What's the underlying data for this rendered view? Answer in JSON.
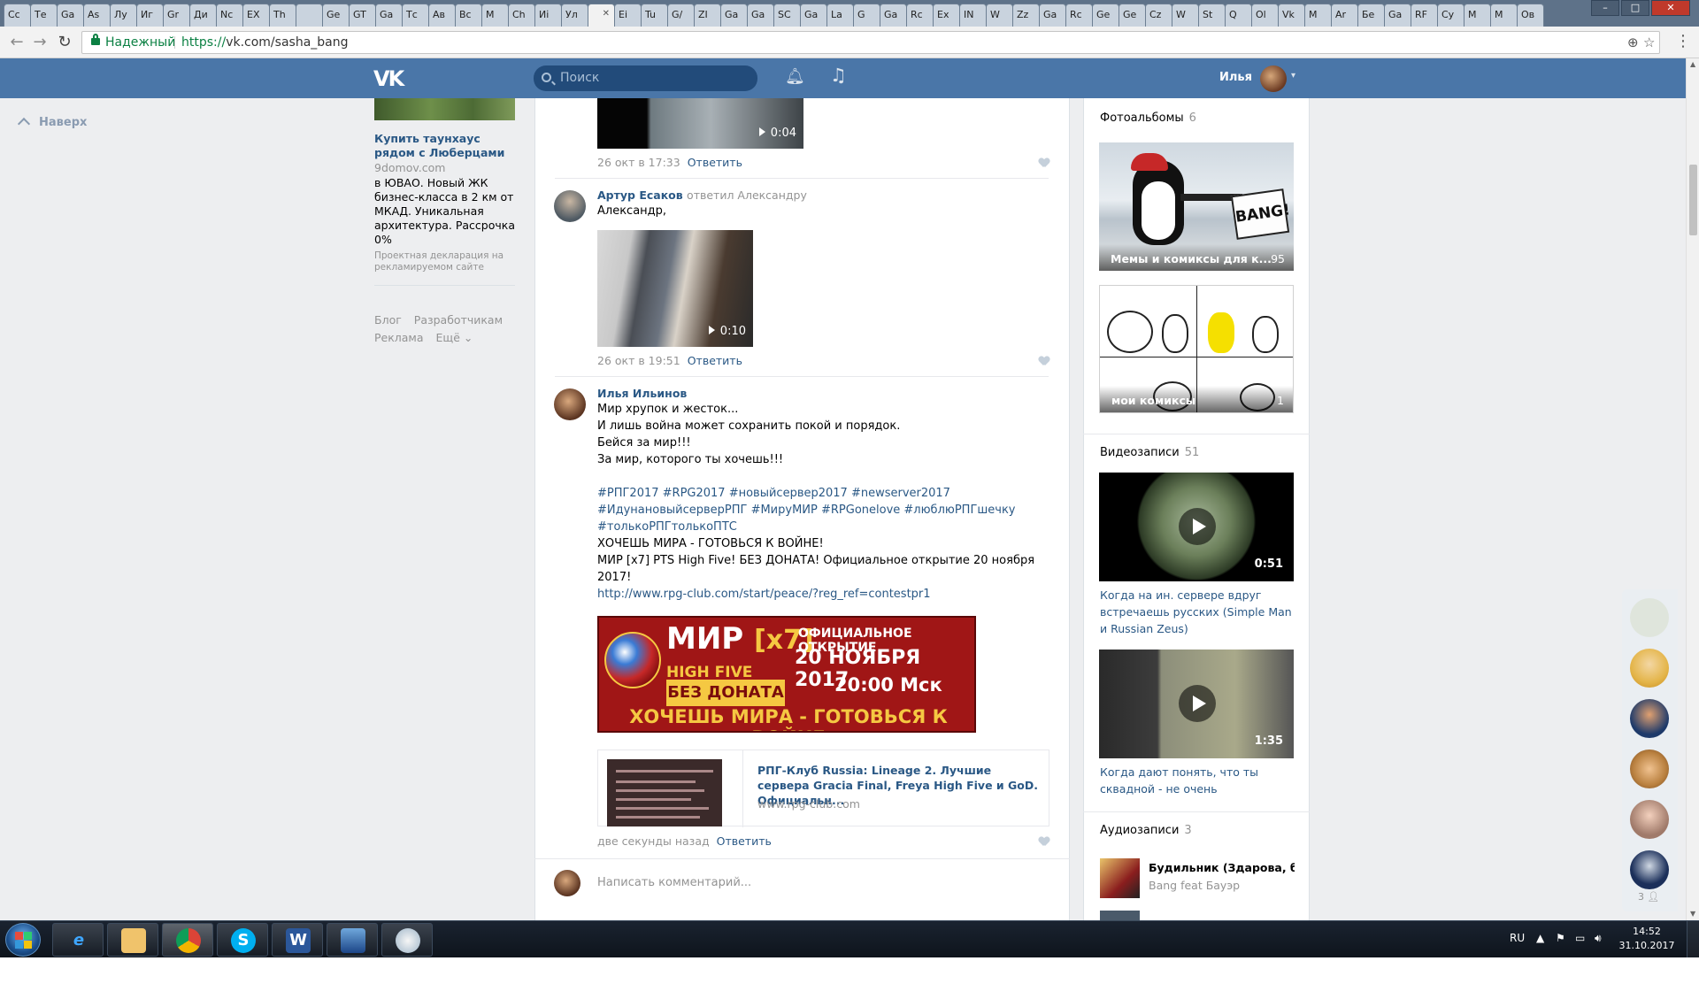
{
  "browser": {
    "tabs": [
      "Сс",
      "Те",
      "Ga",
      "As",
      "Лу",
      "Иг",
      "Gr",
      "Ди",
      "Nc",
      "EX",
      "Th",
      "",
      "Ge",
      "GT",
      "Ga",
      "Тс",
      "Ав",
      "Вс",
      "М",
      "Ch",
      "Иі",
      "Ул",
      "",
      "Ei",
      "Tu",
      "G/",
      "ZI",
      "Ga",
      "Ga",
      "SC",
      "Ga",
      "La",
      "G",
      "Ga",
      "Rc",
      "Ex",
      "IN",
      "W",
      "Zz",
      "Ga",
      "Rc",
      "Ge",
      "Ge",
      "Cz",
      "W",
      "St",
      "Q",
      "Ol",
      "Vk",
      "M",
      "Ar",
      "Бе",
      "Ga",
      "RF",
      "Cy",
      "M",
      "M",
      "Ов"
    ],
    "active_tab_index": 22,
    "secure_label": "Надежный",
    "url_proto": "https://",
    "url_rest": "vk.com/sasha_bang"
  },
  "header": {
    "logo": "VK",
    "search_placeholder": "Поиск",
    "user_name": "Илья"
  },
  "to_top": "Наверх",
  "ad": {
    "title": "Купить таунхаус рядом с Люберцами",
    "domain": "9domov.com",
    "description": "в ЮВАО. Новый ЖК бизнес-класса в 2 км от МКАД. Уникальная архитектура. Рассрочка 0%",
    "legal": "Проектная декларация на рекламируемом сайте"
  },
  "footer_links": [
    "Блог",
    "Разработчикам",
    "Реклама",
    "Ещё ⌄"
  ],
  "comments": [
    {
      "video_duration": "0:04",
      "time": "26 окт в 17:33",
      "reply": "Ответить"
    },
    {
      "author": "Артур Есаков",
      "answered": "ответил Александру",
      "text": "Александр,",
      "video_duration": "0:10",
      "time": "26 окт в 19:51",
      "reply": "Ответить"
    },
    {
      "author": "Илья Ильинов",
      "text": "Мир хрупок и жесток...\nИ лишь война может сохранить покой и порядок.\nБейся за мир!!!\nЗа мир, которого ты хочешь!!!",
      "hashtags": "#РПГ2017 #RPG2017 #новыйсервер2017 #newserver2017\n#ИдунановыйсерверРПГ #МируМИР #RPGonelove #люблюРПГшечку\n#толькоРПГтолькоПТС",
      "text2": "ХОЧЕШЬ МИРА - ГОТОВЬСЯ К ВОЙНЕ!\nМИР [x7] PTS High Five! БЕЗ ДОНАТА! Официальное открытие 20 ноября 2017!",
      "link": "http://www.rpg-club.com/start/peace/?reg_ref=contestpr1",
      "banner": {
        "l1": "МИР",
        "l1b": "[x7]",
        "l2": "ОФИЦИАЛЬНОЕ ОТКРЫТИЕ",
        "l3": "20 НОЯБРЯ 2017",
        "l4": "20:00 Мск",
        "l5": "HIGH FIVE",
        "l6": "БЕЗ ДОНАТА",
        "l7": "ХОЧЕШЬ МИРА - ГОТОВЬСЯ К ВОЙНЕ"
      },
      "snippet_title": "РПГ-Клуб Russia: Lineage 2. Лучшие сервера Gracia Final, Freya High Five и GoD. Официальн...",
      "snippet_domain": "www.rpg-club.com",
      "time": "две секунды назад",
      "reply": "Ответить"
    }
  ],
  "write_comment_placeholder": "Написать комментарий...",
  "right": {
    "albums_title": "Фотоальбомы",
    "albums_count": "6",
    "albums": [
      {
        "name": "Мемы и комиксы для к...",
        "count": "95",
        "badge": "BANG!"
      },
      {
        "name": "мои комиксы",
        "count": "1"
      }
    ],
    "videos_title": "Видеозаписи",
    "videos_count": "51",
    "videos": [
      {
        "duration": "0:51",
        "caption": "Когда на ин. сервере вдруг встречаешь русских (Simple Man и Russian Zeus)"
      },
      {
        "duration": "1:35",
        "caption": "Когда дают понять, что ты сквадной - не очень"
      }
    ],
    "audio_title": "Аудиозаписи",
    "audio_count": "3",
    "audio": [
      {
        "title": "Будильник (Здарова, ба...",
        "artist": "Bang feat Бауэр"
      }
    ]
  },
  "friends_count": "3",
  "taskbar": {
    "lang": "RU",
    "time": "14:52",
    "date": "31.10.2017"
  }
}
